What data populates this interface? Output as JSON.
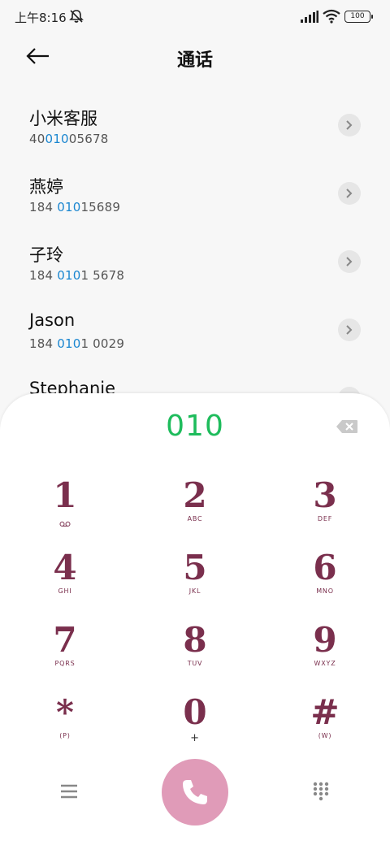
{
  "status_bar": {
    "time": "上午8:16",
    "battery": "100",
    "icons": [
      "mute-icon",
      "signal-icon",
      "wifi-icon",
      "battery-icon"
    ]
  },
  "header": {
    "title": "通话",
    "back_icon": "arrow-left-icon"
  },
  "contacts": [
    {
      "name": "小米客服",
      "number_pre": "40",
      "number_hl": "010",
      "number_post": "05678"
    },
    {
      "name": "燕婷",
      "number_pre": "184 ",
      "number_hl": "010",
      "number_post": "15689"
    },
    {
      "name": "子玲",
      "number_pre": "184 ",
      "number_hl": "010",
      "number_post": "1 5678"
    },
    {
      "name": "Jason",
      "number_pre": "184 ",
      "number_hl": "010",
      "number_post": "1 0029"
    },
    {
      "name": "Stephanie",
      "number_pre": "",
      "number_hl": "",
      "number_post": ""
    }
  ],
  "dialer": {
    "entered": "010",
    "keys": [
      {
        "main": "1",
        "sub": ""
      },
      {
        "main": "2",
        "sub": "ABC"
      },
      {
        "main": "3",
        "sub": "DEF"
      },
      {
        "main": "4",
        "sub": "GHI"
      },
      {
        "main": "5",
        "sub": "JKL"
      },
      {
        "main": "6",
        "sub": "MNO"
      },
      {
        "main": "7",
        "sub": "PQRS"
      },
      {
        "main": "8",
        "sub": "TUV"
      },
      {
        "main": "9",
        "sub": "WXYZ"
      },
      {
        "main": "*",
        "sub": "(P)"
      },
      {
        "main": "0",
        "sub": "+"
      },
      {
        "main": "#",
        "sub": "(W)"
      }
    ],
    "colors": {
      "digits": "#1ebc5c",
      "keys": "#7a2f4d",
      "call_button": "#e09bb8",
      "highlight": "#1a86d0"
    }
  }
}
